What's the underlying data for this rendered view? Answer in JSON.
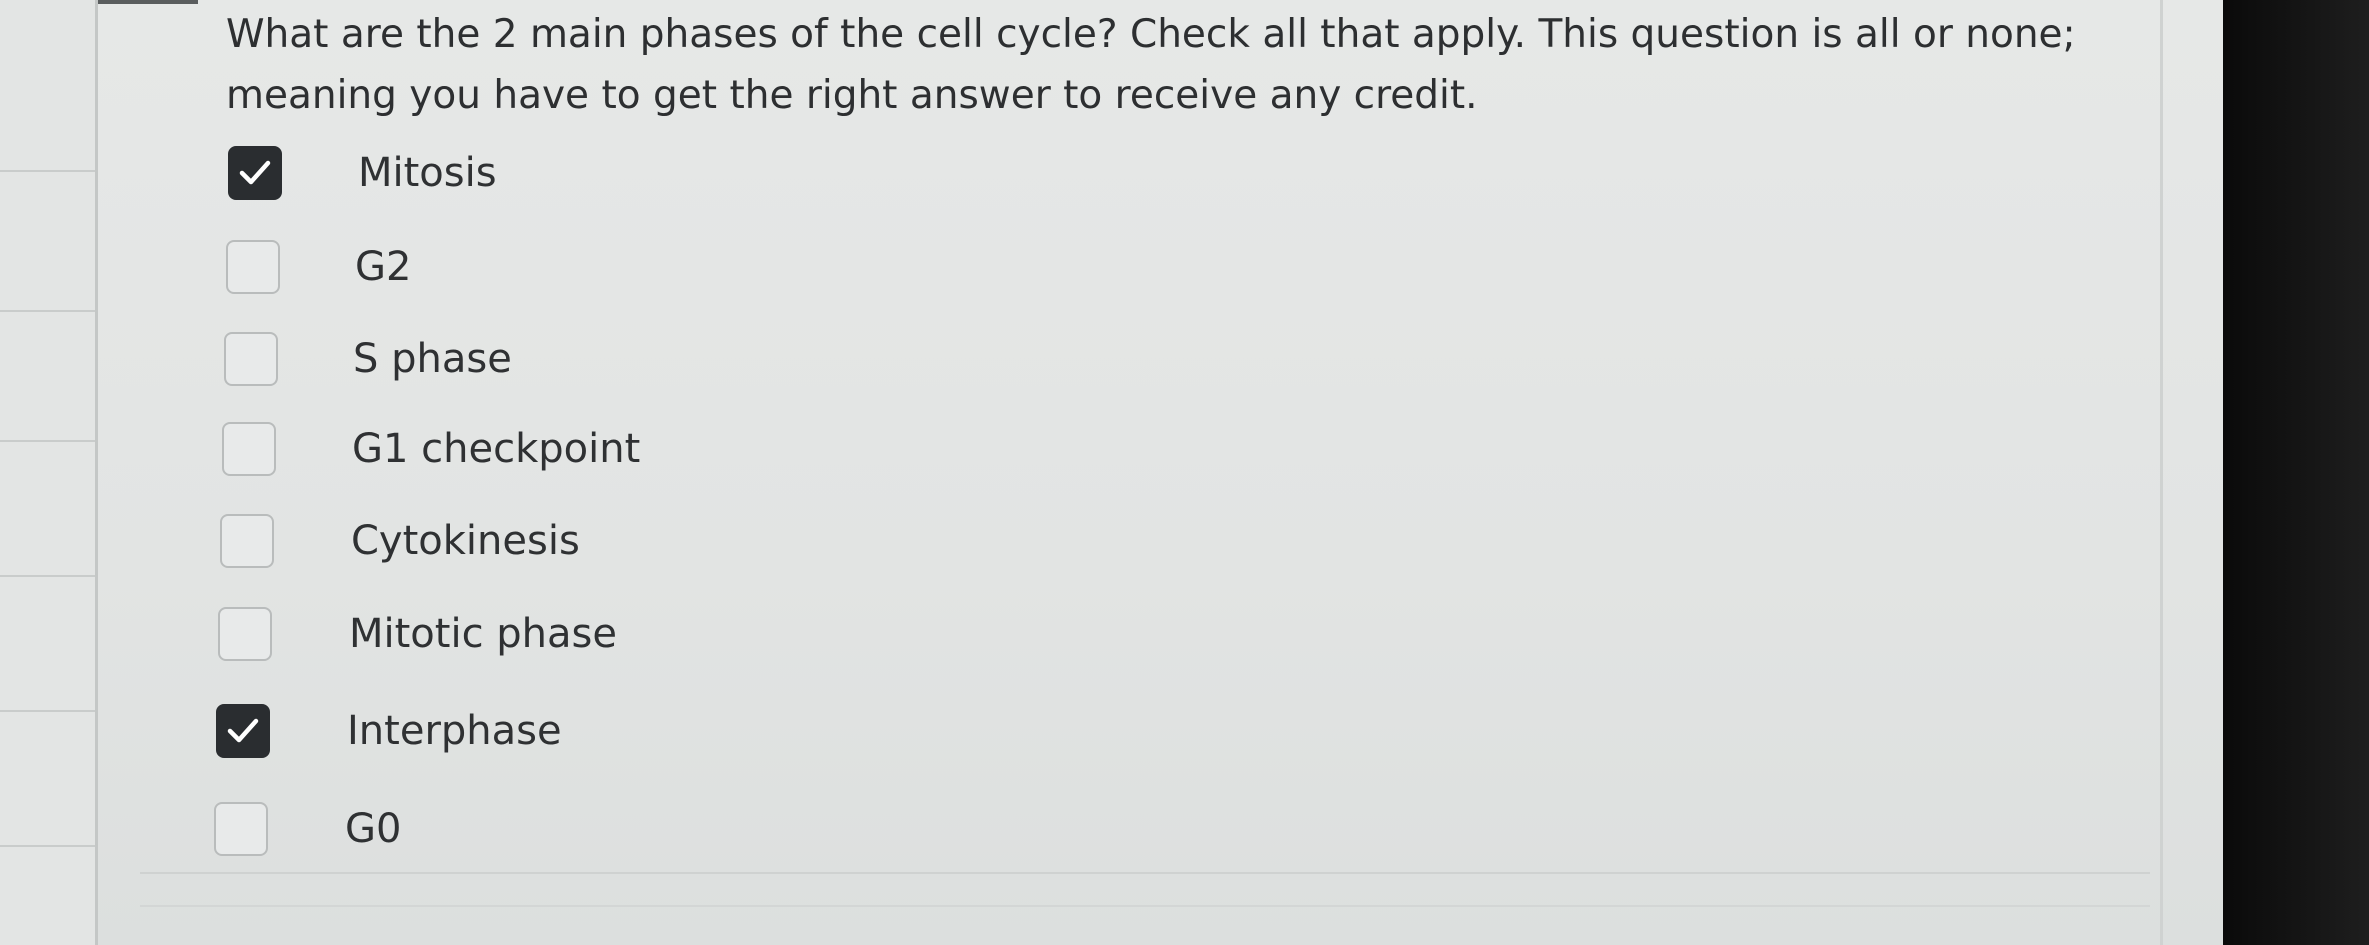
{
  "question": {
    "text": "What are the 2 main phases of the cell cycle? Check all that apply. This question is all or none; meaning you have to get the right answer to receive any credit."
  },
  "options": [
    {
      "label": "Mitosis",
      "checked": true
    },
    {
      "label": "G2",
      "checked": false
    },
    {
      "label": "S phase",
      "checked": false
    },
    {
      "label": "G1 checkpoint",
      "checked": false
    },
    {
      "label": "Cytokinesis",
      "checked": false
    },
    {
      "label": "Mitotic phase",
      "checked": false
    },
    {
      "label": "Interphase",
      "checked": true
    },
    {
      "label": "G0",
      "checked": false
    }
  ],
  "colors": {
    "checked_box": "#2a2d30",
    "unchecked_border": "#b9bcbc",
    "text": "#2d2f31"
  }
}
